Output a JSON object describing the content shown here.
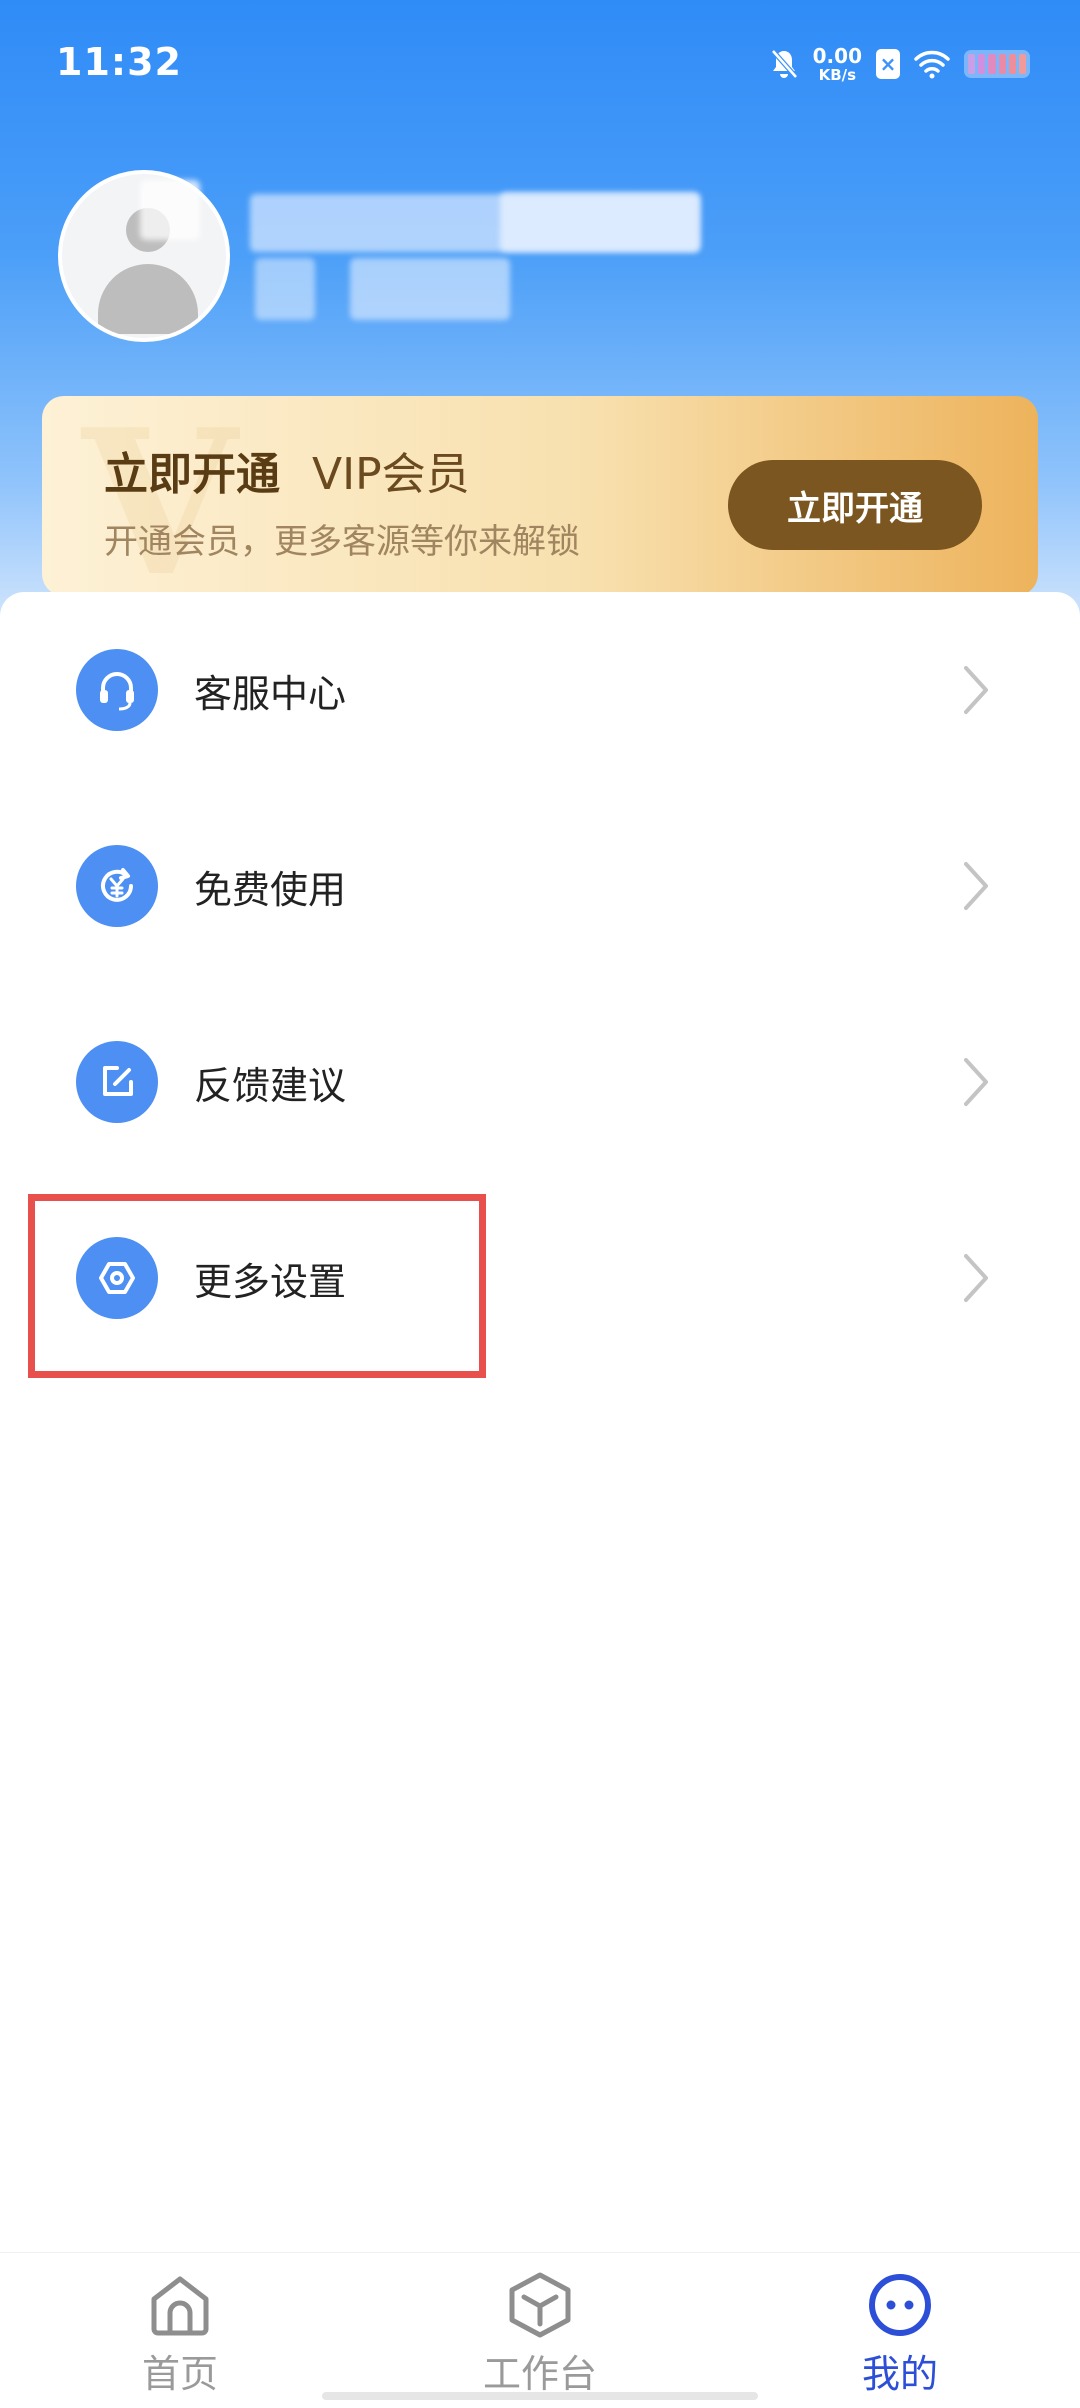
{
  "status_bar": {
    "time": "11:32",
    "net_speed_value": "0.00",
    "net_speed_unit": "KB/s",
    "icons": [
      "mute-bell-icon",
      "box-x-icon",
      "wifi-icon",
      "battery-icon"
    ]
  },
  "vip": {
    "title": "立即开通",
    "subtitle": "VIP会员",
    "watermark": "V",
    "description": "开通会员，更多客源等你来解锁",
    "button_label": "立即开通"
  },
  "menu": {
    "items": [
      {
        "label": "客服中心",
        "icon": "headset-icon"
      },
      {
        "label": "免费使用",
        "icon": "yuan-refresh-icon"
      },
      {
        "label": "反馈建议",
        "icon": "edit-icon"
      },
      {
        "label": "更多设置",
        "icon": "settings-hex-icon"
      }
    ]
  },
  "bottom_nav": {
    "items": [
      {
        "label": "首页",
        "icon": "home-icon",
        "active": false
      },
      {
        "label": "工作台",
        "icon": "cube-icon",
        "active": false
      },
      {
        "label": "我的",
        "icon": "face-icon",
        "active": true
      }
    ]
  },
  "colors": {
    "primary": "#4d8ff2",
    "nav_active": "#2d4fd8",
    "nav_inactive": "#9a9a9a",
    "vip_button": "#7b5620",
    "highlight": "#e8504e"
  }
}
